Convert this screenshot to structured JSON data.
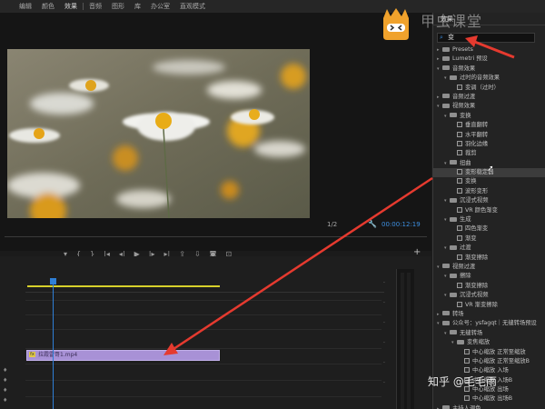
{
  "menu": {
    "items": [
      "编辑",
      "颜色",
      "效果",
      "音频",
      "图形",
      "库",
      "办公室",
      "直观模式"
    ],
    "active_index": 2
  },
  "monitor": {
    "fraction": "1/2",
    "timecode": "00:00:12:19"
  },
  "timeline": {
    "clip_label": "拉霞雷哥1.mp4"
  },
  "panel": {
    "title": "效果",
    "search_value": "变"
  },
  "tree": [
    {
      "depth": 0,
      "kind": "folder",
      "open": false,
      "label": "Presets"
    },
    {
      "depth": 0,
      "kind": "folder",
      "open": false,
      "label": "Lumetri 预设"
    },
    {
      "depth": 0,
      "kind": "folder",
      "open": true,
      "label": "音频效果"
    },
    {
      "depth": 1,
      "kind": "folder",
      "open": true,
      "label": "过时的音频效果"
    },
    {
      "depth": 2,
      "kind": "effect",
      "label": "变调（过时）"
    },
    {
      "depth": 0,
      "kind": "folder",
      "open": false,
      "label": "音频过渡"
    },
    {
      "depth": 0,
      "kind": "folder",
      "open": true,
      "label": "视频效果"
    },
    {
      "depth": 1,
      "kind": "folder",
      "open": true,
      "label": "变换"
    },
    {
      "depth": 2,
      "kind": "effect",
      "label": "垂直翻转"
    },
    {
      "depth": 2,
      "kind": "effect",
      "label": "水平翻转"
    },
    {
      "depth": 2,
      "kind": "effect",
      "label": "羽化边缘"
    },
    {
      "depth": 2,
      "kind": "effect",
      "label": "裁剪"
    },
    {
      "depth": 1,
      "kind": "folder",
      "open": true,
      "label": "扭曲"
    },
    {
      "depth": 2,
      "kind": "effect",
      "label": "变形稳定器",
      "selected": true
    },
    {
      "depth": 2,
      "kind": "effect",
      "label": "变换"
    },
    {
      "depth": 2,
      "kind": "effect",
      "label": "波形变形"
    },
    {
      "depth": 1,
      "kind": "folder",
      "open": true,
      "label": "沉浸式视频"
    },
    {
      "depth": 2,
      "kind": "effect",
      "label": "VR 颜色渐变"
    },
    {
      "depth": 1,
      "kind": "folder",
      "open": true,
      "label": "生成"
    },
    {
      "depth": 2,
      "kind": "effect",
      "label": "四色渐变"
    },
    {
      "depth": 2,
      "kind": "effect",
      "label": "渐变"
    },
    {
      "depth": 1,
      "kind": "folder",
      "open": true,
      "label": "过渡"
    },
    {
      "depth": 2,
      "kind": "effect",
      "label": "渐变擦除"
    },
    {
      "depth": 0,
      "kind": "folder",
      "open": true,
      "label": "视频过渡"
    },
    {
      "depth": 1,
      "kind": "folder",
      "open": true,
      "label": "擦除"
    },
    {
      "depth": 2,
      "kind": "effect",
      "label": "渐变擦除"
    },
    {
      "depth": 1,
      "kind": "folder",
      "open": true,
      "label": "沉浸式视频"
    },
    {
      "depth": 2,
      "kind": "effect",
      "label": "VR 渐变擦除"
    },
    {
      "depth": 0,
      "kind": "folder",
      "open": false,
      "label": "转场"
    },
    {
      "depth": 0,
      "kind": "folder",
      "open": true,
      "label": "公众号：ysfagqt｜无缝转场预设"
    },
    {
      "depth": 1,
      "kind": "folder",
      "open": true,
      "label": "无缝转场"
    },
    {
      "depth": 2,
      "kind": "folder",
      "open": true,
      "label": "变焦缩放"
    },
    {
      "depth": 3,
      "kind": "effect",
      "label": "中心缩放 正常至缩放"
    },
    {
      "depth": 3,
      "kind": "effect",
      "label": "中心缩放 正常至缩放B"
    },
    {
      "depth": 3,
      "kind": "effect",
      "label": "中心缩放 入场"
    },
    {
      "depth": 3,
      "kind": "effect",
      "label": "中心缩放 入场B"
    },
    {
      "depth": 3,
      "kind": "effect",
      "label": "中心缩放 出场"
    },
    {
      "depth": 3,
      "kind": "effect",
      "label": "中心缩放 出场B"
    },
    {
      "depth": 0,
      "kind": "folder",
      "open": false,
      "label": "主持人调色"
    },
    {
      "depth": 0,
      "kind": "folder",
      "open": false,
      "label": "音频效果"
    }
  ],
  "overlay": {
    "logo_text": "甲虫课堂",
    "watermark": "知乎 @毛毛雨"
  },
  "colors": {
    "accent_blue": "#3b8de0",
    "annotation_red": "#e53a2f",
    "clip_purple": "#a891d6",
    "logo_orange": "#f0a22c"
  }
}
